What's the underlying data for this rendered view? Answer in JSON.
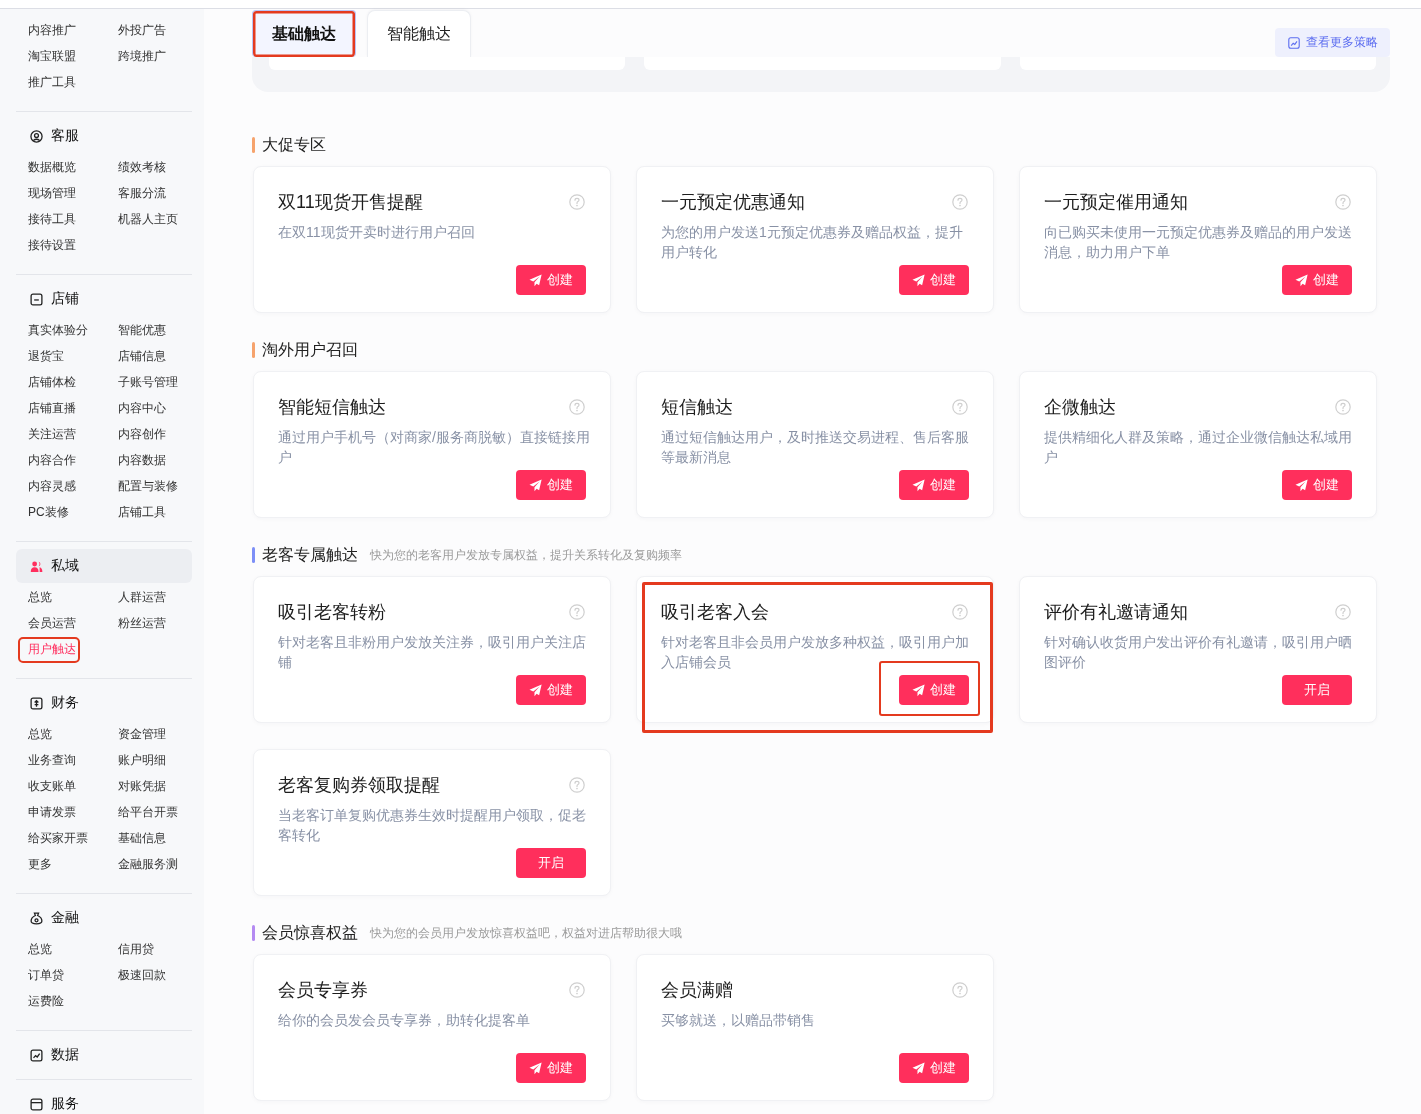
{
  "sidebar": {
    "top_items": [
      {
        "label": "内容推广",
        "selected": false,
        "highlighted": false
      },
      {
        "label": "外投广告",
        "selected": false,
        "highlighted": false
      },
      {
        "label": "淘宝联盟",
        "selected": false,
        "highlighted": false
      },
      {
        "label": "跨境推广",
        "selected": false,
        "highlighted": false
      },
      {
        "label": "推广工具",
        "selected": false,
        "highlighted": false
      }
    ],
    "groups": [
      {
        "title": "客服",
        "selected": false,
        "items": [
          {
            "label": "数据概览",
            "selected": false,
            "highlighted": false
          },
          {
            "label": "绩效考核",
            "selected": false,
            "highlighted": false
          },
          {
            "label": "现场管理",
            "selected": false,
            "highlighted": false
          },
          {
            "label": "客服分流",
            "selected": false,
            "highlighted": false
          },
          {
            "label": "接待工具",
            "selected": false,
            "highlighted": false
          },
          {
            "label": "机器人主页",
            "selected": false,
            "highlighted": false
          },
          {
            "label": "接待设置",
            "selected": false,
            "highlighted": false
          }
        ]
      },
      {
        "title": "店铺",
        "selected": false,
        "items": [
          {
            "label": "真实体验分",
            "selected": false,
            "highlighted": false
          },
          {
            "label": "智能优惠",
            "selected": false,
            "highlighted": false
          },
          {
            "label": "退货宝",
            "selected": false,
            "highlighted": false
          },
          {
            "label": "店铺信息",
            "selected": false,
            "highlighted": false
          },
          {
            "label": "店铺体检",
            "selected": false,
            "highlighted": false
          },
          {
            "label": "子账号管理",
            "selected": false,
            "highlighted": false
          },
          {
            "label": "店铺直播",
            "selected": false,
            "highlighted": false
          },
          {
            "label": "内容中心",
            "selected": false,
            "highlighted": false
          },
          {
            "label": "关注运营",
            "selected": false,
            "highlighted": false
          },
          {
            "label": "内容创作",
            "selected": false,
            "highlighted": false
          },
          {
            "label": "内容合作",
            "selected": false,
            "highlighted": false
          },
          {
            "label": "内容数据",
            "selected": false,
            "highlighted": false
          },
          {
            "label": "内容灵感",
            "selected": false,
            "highlighted": false
          },
          {
            "label": "配置与装修",
            "selected": false,
            "highlighted": false
          },
          {
            "label": "PC装修",
            "selected": false,
            "highlighted": false
          },
          {
            "label": "店铺工具",
            "selected": false,
            "highlighted": false
          }
        ]
      },
      {
        "title": "私域",
        "selected": true,
        "items": [
          {
            "label": "总览",
            "selected": false,
            "highlighted": false
          },
          {
            "label": "人群运营",
            "selected": false,
            "highlighted": false
          },
          {
            "label": "会员运营",
            "selected": false,
            "highlighted": false
          },
          {
            "label": "粉丝运营",
            "selected": false,
            "highlighted": false
          },
          {
            "label": "用户触达",
            "selected": true,
            "highlighted": true
          }
        ]
      },
      {
        "title": "财务",
        "selected": false,
        "items": [
          {
            "label": "总览",
            "selected": false,
            "highlighted": false
          },
          {
            "label": "资金管理",
            "selected": false,
            "highlighted": false
          },
          {
            "label": "业务查询",
            "selected": false,
            "highlighted": false
          },
          {
            "label": "账户明细",
            "selected": false,
            "highlighted": false
          },
          {
            "label": "收支账单",
            "selected": false,
            "highlighted": false
          },
          {
            "label": "对账凭据",
            "selected": false,
            "highlighted": false
          },
          {
            "label": "申请发票",
            "selected": false,
            "highlighted": false
          },
          {
            "label": "给平台开票",
            "selected": false,
            "highlighted": false
          },
          {
            "label": "给买家开票",
            "selected": false,
            "highlighted": false
          },
          {
            "label": "基础信息",
            "selected": false,
            "highlighted": false
          },
          {
            "label": "更多",
            "selected": false,
            "highlighted": false
          },
          {
            "label": "金融服务测",
            "selected": false,
            "highlighted": false
          }
        ]
      },
      {
        "title": "金融",
        "selected": false,
        "items": [
          {
            "label": "总览",
            "selected": false,
            "highlighted": false
          },
          {
            "label": "信用贷",
            "selected": false,
            "highlighted": false
          },
          {
            "label": "订单贷",
            "selected": false,
            "highlighted": false
          },
          {
            "label": "极速回款",
            "selected": false,
            "highlighted": false
          },
          {
            "label": "运费险",
            "selected": false,
            "highlighted": false
          }
        ]
      },
      {
        "title": "数据",
        "selected": false
      },
      {
        "title": "服务",
        "selected": false
      }
    ]
  },
  "tabs": [
    {
      "label": "基础触达",
      "selected": true,
      "highlighted": true
    },
    {
      "label": "智能触达",
      "selected": false,
      "highlighted": false
    }
  ],
  "more_button": {
    "label": "查看更多策略"
  },
  "sections": [
    {
      "title": "大促专区",
      "color": "#f6a36d",
      "cards": [
        {
          "title": "双11现货开售提醒",
          "description": "在双11现货开卖时进行用户召回",
          "highlighted": false,
          "button": {
            "kind": "create",
            "label": "创建",
            "highlighted": false
          }
        },
        {
          "title": "一元预定优惠通知",
          "description": "为您的用户发送1元预定优惠券及赠品权益，提升用户转化",
          "highlighted": false,
          "button": {
            "kind": "create",
            "label": "创建",
            "highlighted": false
          }
        },
        {
          "title": "一元预定催用通知",
          "description": "向已购买未使用一元预定优惠券及赠品的用户发送消息，助力用户下单",
          "highlighted": false,
          "button": {
            "kind": "create",
            "label": "创建",
            "highlighted": false
          }
        }
      ]
    },
    {
      "title": "淘外用户召回",
      "color": "#f6a36d",
      "cards": [
        {
          "title": "智能短信触达",
          "description": "通过用户手机号（对商家/服务商脱敏）直接链接用户",
          "highlighted": false,
          "button": {
            "kind": "create",
            "label": "创建",
            "highlighted": false
          }
        },
        {
          "title": "短信触达",
          "description": "通过短信触达用户，及时推送交易进程、售后客服等最新消息",
          "highlighted": false,
          "button": {
            "kind": "create",
            "label": "创建",
            "highlighted": false
          }
        },
        {
          "title": "企微触达",
          "description": "提供精细化人群及策略，通过企业微信触达私域用户",
          "highlighted": false,
          "button": {
            "kind": "create",
            "label": "创建",
            "highlighted": false
          }
        }
      ]
    },
    {
      "title": "老客专属触达",
      "subtitle": "快为您的老客用户发放专属权益，提升关系转化及复购频率",
      "color": "#7d8ff7",
      "cards": [
        {
          "title": "吸引老客转粉",
          "description": "针对老客且非粉用户发放关注券，吸引用户关注店铺",
          "highlighted": false,
          "button": {
            "kind": "create",
            "label": "创建",
            "highlighted": false
          }
        },
        {
          "title": "吸引老客入会",
          "description": "针对老客且非会员用户发放多种权益，吸引用户加入店铺会员",
          "highlighted": true,
          "button": {
            "kind": "create",
            "label": "创建",
            "highlighted": true
          }
        },
        {
          "title": "评价有礼邀请通知",
          "description": "针对确认收货用户发出评价有礼邀请，吸引用户晒图评价",
          "highlighted": false,
          "button": {
            "kind": "enable",
            "label": "开启",
            "highlighted": false
          }
        },
        {
          "title": "老客复购券领取提醒",
          "description": "当老客订单复购优惠券生效时提醒用户领取，促老客转化",
          "highlighted": false,
          "button": {
            "kind": "enable",
            "label": "开启",
            "highlighted": false
          }
        }
      ]
    },
    {
      "title": "会员惊喜权益",
      "subtitle": "快为您的会员用户发放惊喜权益吧，权益对进店帮助很大哦",
      "color": "#b48af2",
      "cards": [
        {
          "title": "会员专享券",
          "description": "给你的会员发会员专享券，助转化提客单",
          "highlighted": false,
          "button": {
            "kind": "create",
            "label": "创建",
            "highlighted": false
          }
        },
        {
          "title": "会员满赠",
          "description": "买够就送，以赠品带销售",
          "highlighted": false,
          "button": {
            "kind": "create",
            "label": "创建",
            "highlighted": false
          }
        }
      ]
    }
  ]
}
